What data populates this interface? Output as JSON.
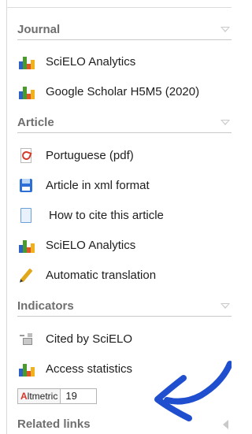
{
  "sections": {
    "journal": "Journal",
    "article": "Article",
    "indicators": "Indicators",
    "related": "Related links"
  },
  "journal_items": {
    "analytics": "SciELO Analytics",
    "scholar": "Google Scholar H5M5 (2020)"
  },
  "article_items": {
    "pdf": "Portuguese (pdf)",
    "xml": "Article in xml format",
    "cite": "How to cite this article",
    "analytics": "SciELO Analytics",
    "translation": "Automatic translation"
  },
  "indicator_items": {
    "cited": "Cited by SciELO",
    "access": "Access statistics"
  },
  "altmetric": {
    "logo_a": "A",
    "logo_rest": "ltmetric",
    "score": "19"
  },
  "colors": {
    "annotation_arrow": "#1f4fcf"
  },
  "icons": [
    "bar-chart-icon",
    "pdf-icon",
    "xml-file-icon",
    "document-icon",
    "pen-icon",
    "cited-icon"
  ]
}
